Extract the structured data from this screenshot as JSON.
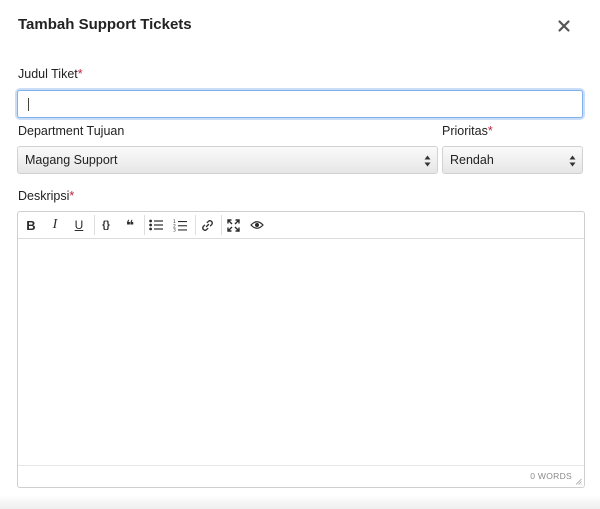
{
  "modal": {
    "title": "Tambah Support Tickets",
    "close_icon": "close-icon"
  },
  "form": {
    "title_field": {
      "label": "Judul Tiket",
      "required_mark": "*",
      "value": ""
    },
    "department_field": {
      "label": "Department Tujuan",
      "selected": "Magang Support"
    },
    "priority_field": {
      "label": "Prioritas",
      "required_mark": "*",
      "selected": "Rendah"
    },
    "description_field": {
      "label": "Deskripsi",
      "required_mark": "*"
    }
  },
  "editor": {
    "toolbar": [
      {
        "name": "bold-button",
        "icon": "bold-icon",
        "glyph": "B"
      },
      {
        "name": "italic-button",
        "icon": "italic-icon",
        "glyph": "I"
      },
      {
        "name": "underline-button",
        "icon": "underline-icon",
        "glyph": "U"
      },
      {
        "name": "code-button",
        "icon": "code-braces-icon",
        "glyph": "{}"
      },
      {
        "name": "quote-button",
        "icon": "quote-icon",
        "glyph": "❝"
      },
      {
        "name": "unordered-list-button",
        "icon": "bullet-list-icon"
      },
      {
        "name": "ordered-list-button",
        "icon": "numbered-list-icon"
      },
      {
        "name": "link-button",
        "icon": "link-icon"
      },
      {
        "name": "fullscreen-button",
        "icon": "fullscreen-icon"
      },
      {
        "name": "preview-button",
        "icon": "eye-icon"
      }
    ],
    "word_count": "0 WORDS"
  },
  "colors": {
    "required": "#c0213a",
    "focus_border": "#7fb0ec"
  }
}
